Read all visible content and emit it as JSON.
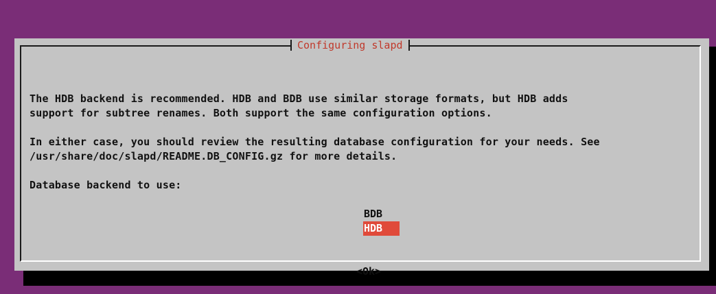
{
  "dialog": {
    "title": "Configuring slapd",
    "lines": [
      "The HDB backend is recommended. HDB and BDB use similar storage formats, but HDB adds",
      "support for subtree renames. Both support the same configuration options.",
      "In either case, you should review the resulting database configuration for your needs. See",
      "/usr/share/doc/slapd/README.DB_CONFIG.gz for more details.",
      "Database backend to use:"
    ],
    "options": [
      "BDB",
      "HDB"
    ],
    "selected_option": "HDB",
    "ok_label": "<Ok>"
  },
  "colors": {
    "background": "#7a2d77",
    "dialog": "#c4c4c4",
    "title": "#c0392b",
    "selection": "#e04a3a"
  }
}
